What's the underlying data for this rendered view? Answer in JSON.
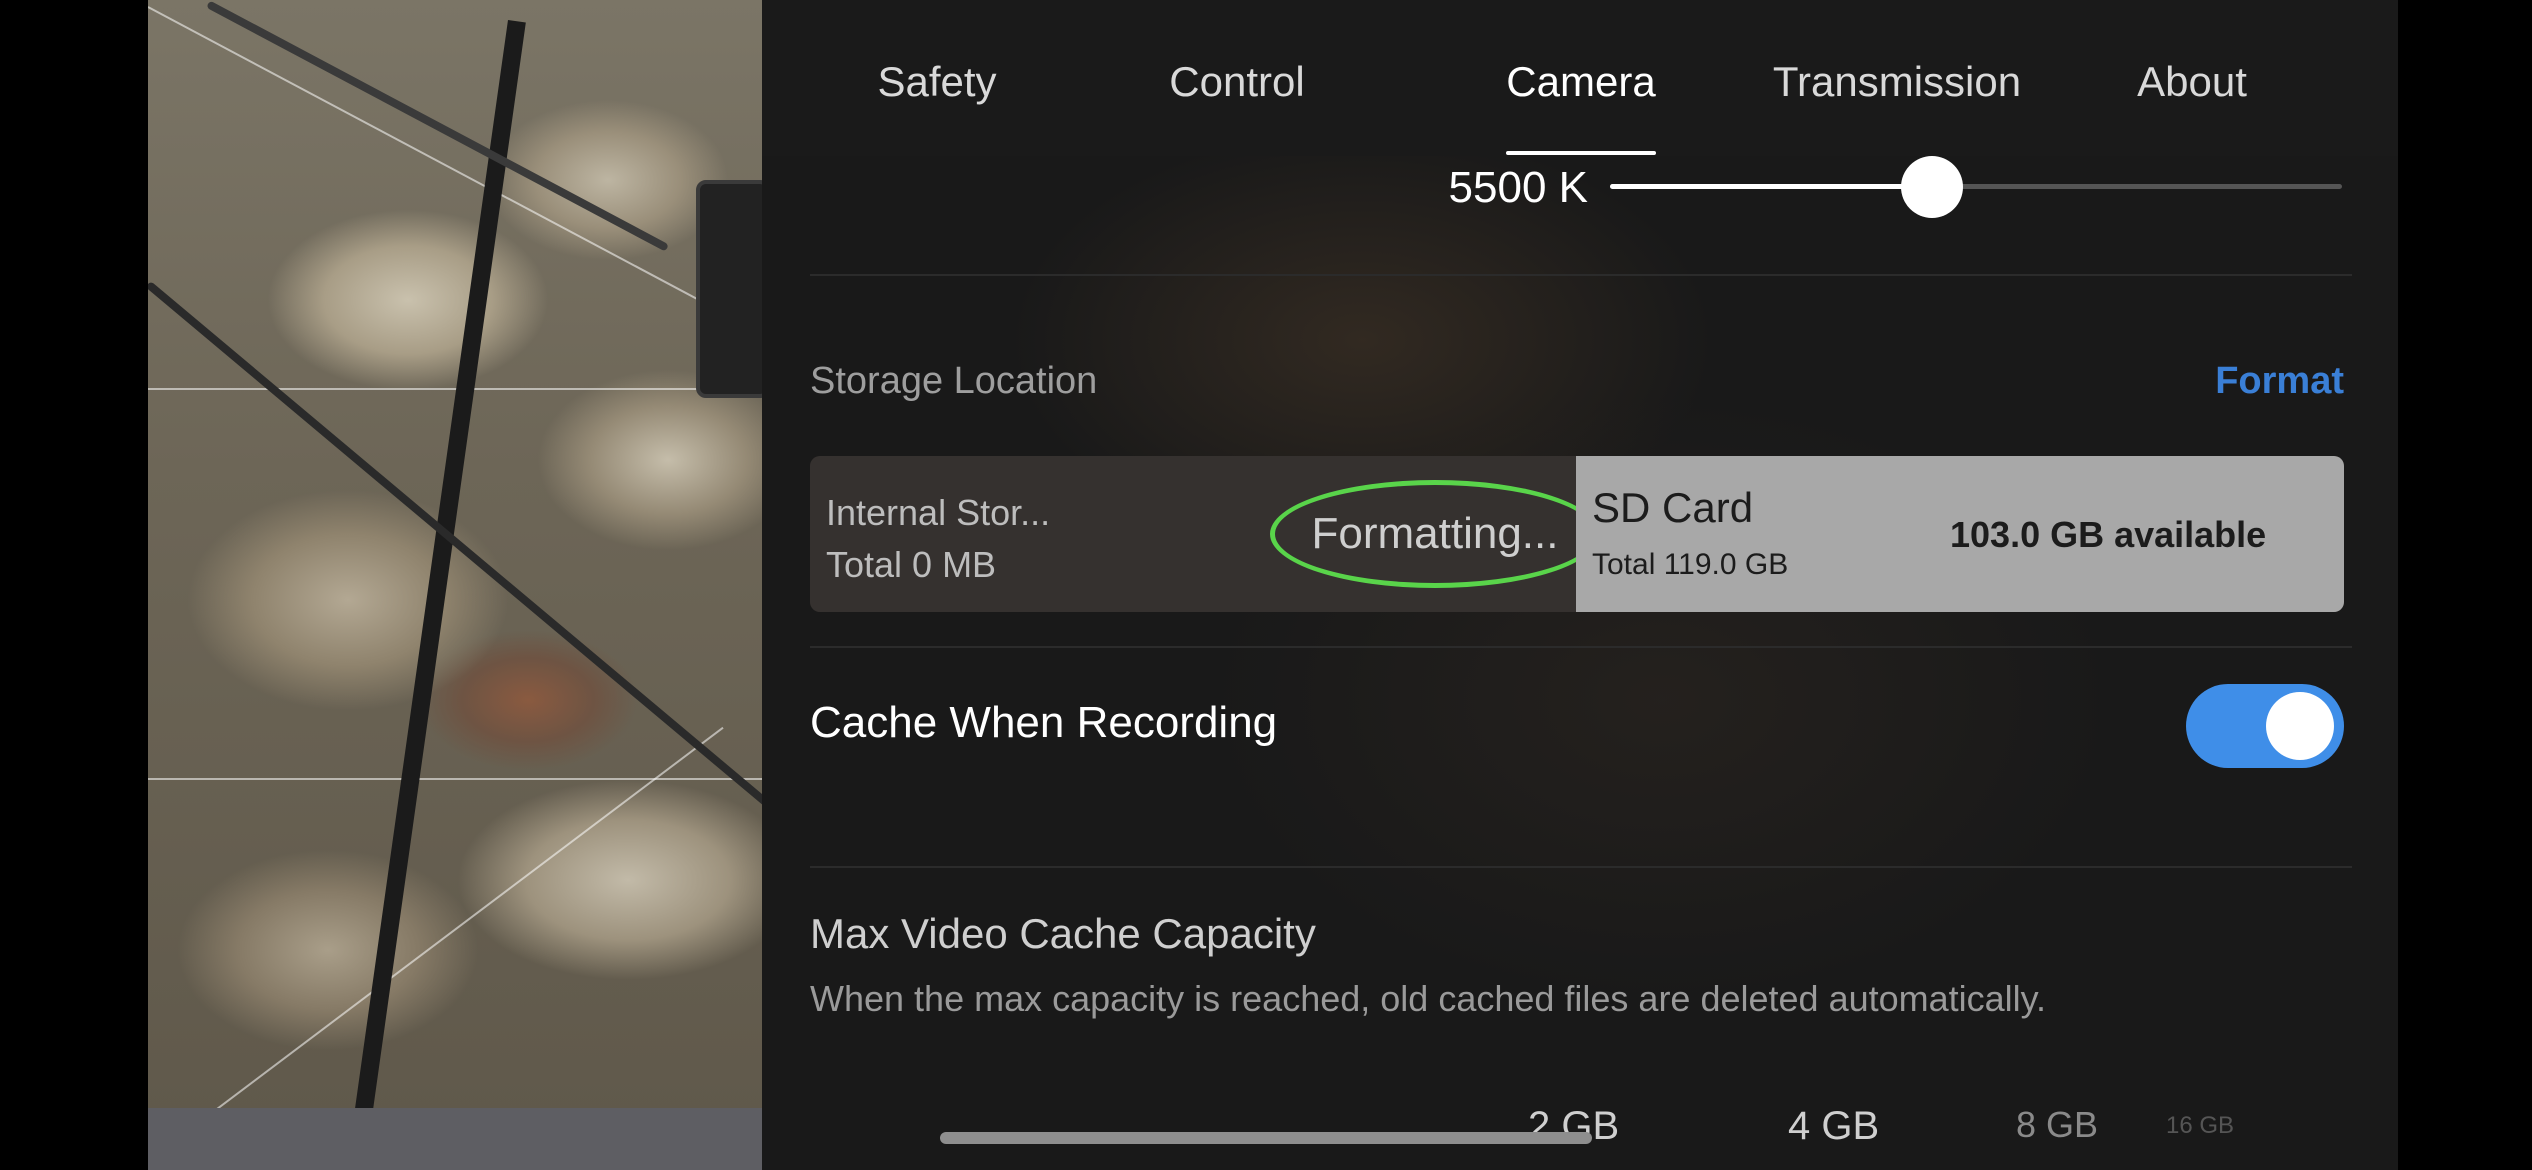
{
  "tabs": [
    {
      "label": "Safety"
    },
    {
      "label": "Control"
    },
    {
      "label": "Camera",
      "active": true
    },
    {
      "label": "Transmission"
    },
    {
      "label": "About"
    }
  ],
  "white_balance": {
    "value_label": "5500 K",
    "slider_fraction": 0.44
  },
  "storage": {
    "header": "Storage Location",
    "format_label": "Format",
    "internal": {
      "name": "Internal Stor...",
      "total": "Total 0 MB"
    },
    "formatting_status": "Formatting...",
    "sd_card": {
      "name": "SD Card",
      "total": "Total 119.0 GB",
      "available": "103.0 GB available",
      "selected": true
    }
  },
  "cache_when_recording": {
    "label": "Cache When Recording",
    "enabled": true
  },
  "max_video_cache": {
    "title": "Max Video Cache Capacity",
    "description": "When the max capacity is reached, old cached files are deleted automatically.",
    "options": [
      "2 GB",
      "4 GB",
      "8 GB",
      "16 GB"
    ]
  },
  "colors": {
    "accent_blue": "#3f8ee8",
    "format_link": "#3a7fd6",
    "highlight_green": "#59d44a"
  }
}
